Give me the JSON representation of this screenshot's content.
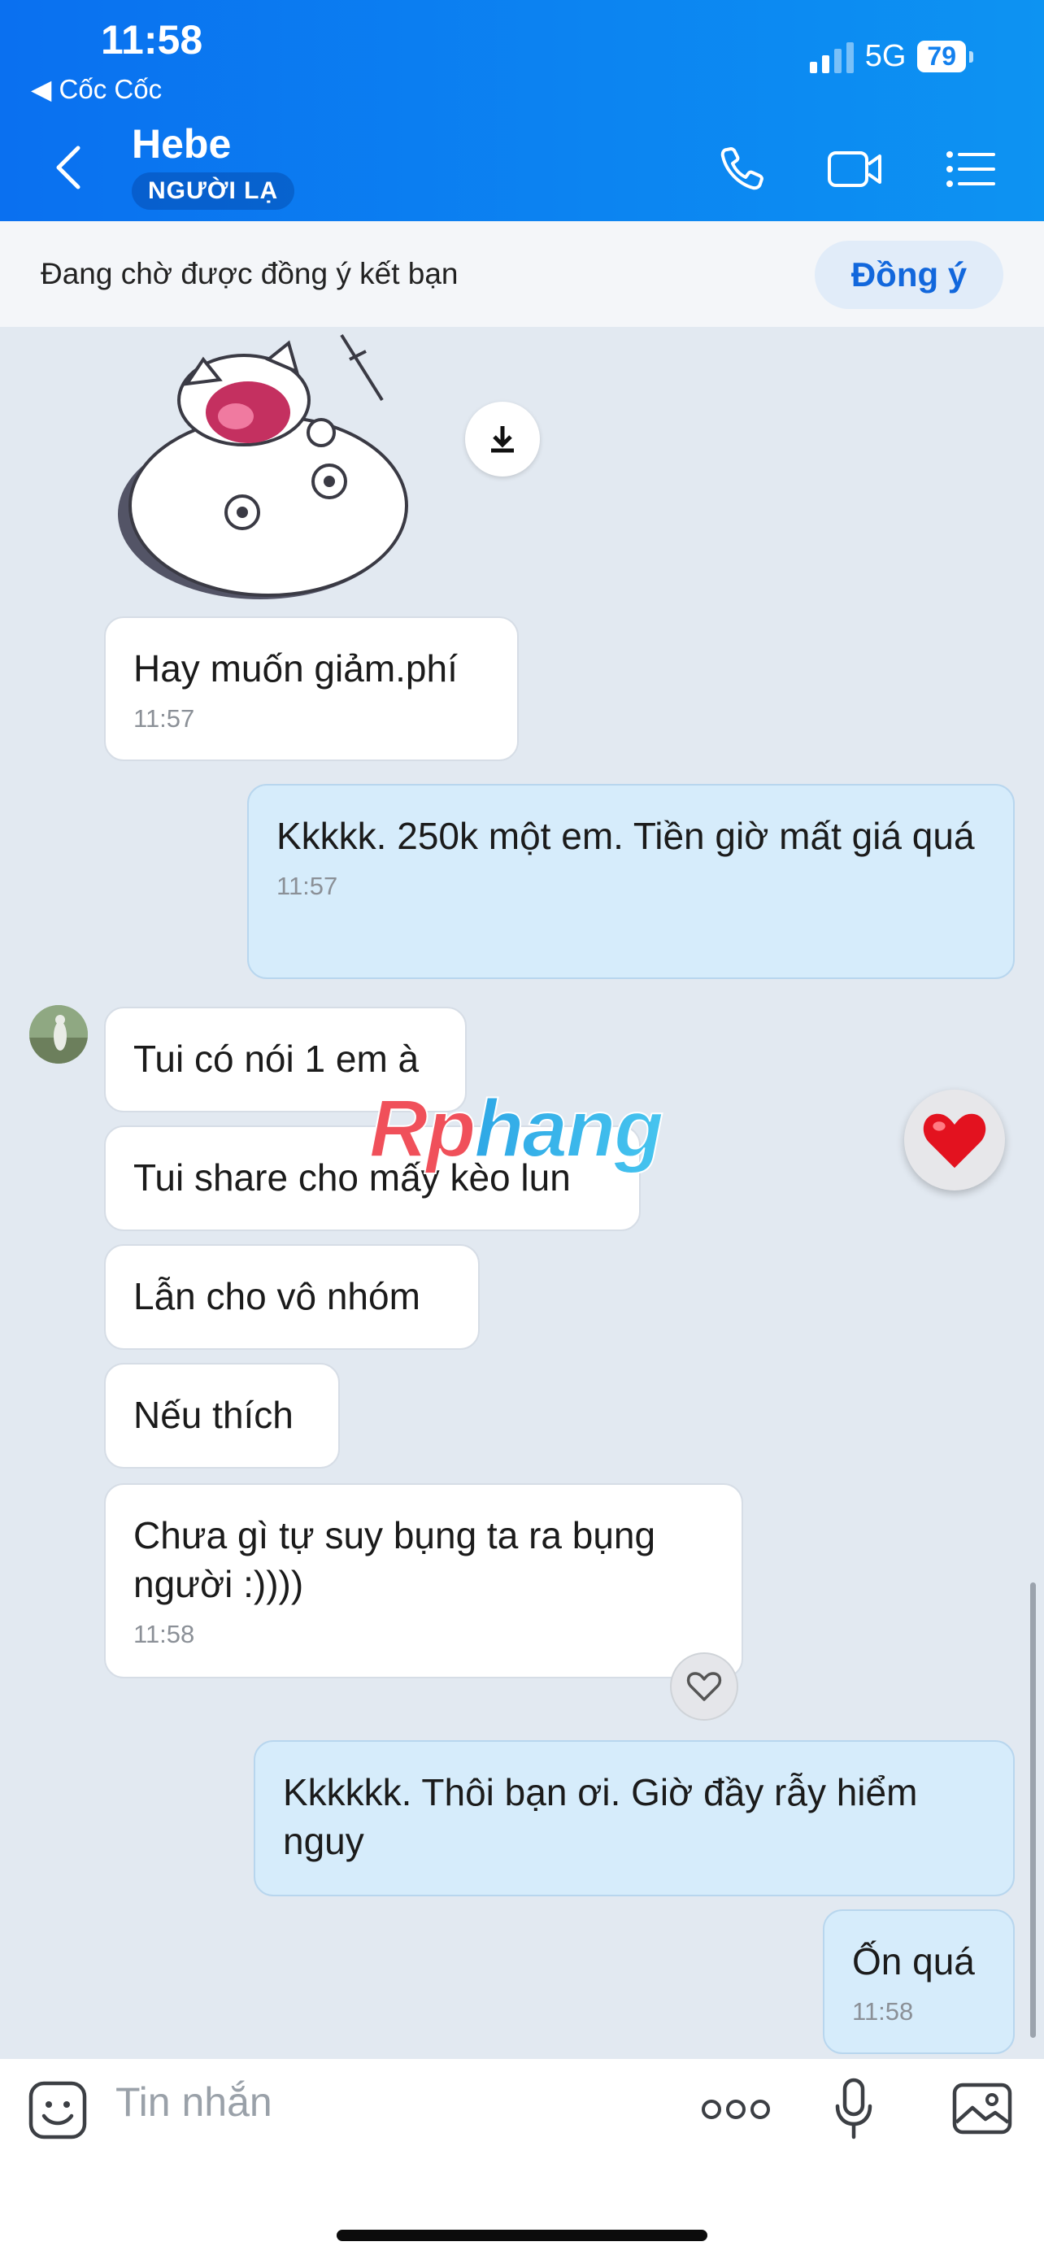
{
  "status_bar": {
    "time": "11:58",
    "back_app": "◀ Cốc Cốc",
    "network": "5G",
    "battery": "79"
  },
  "header": {
    "contact_name": "Hebe",
    "badge": "NGƯỜI LẠ",
    "icons": [
      "back-chevron-icon",
      "phone-icon",
      "video-call-icon",
      "menu-list-icon"
    ]
  },
  "banner": {
    "text": "Đang chờ được đồng ý kết bạn",
    "accept_label": "Đồng ý"
  },
  "watermark": "Rphang",
  "messages": [
    {
      "side": "received",
      "text": "Hay muốn giảm.phí",
      "time": "11:57"
    },
    {
      "side": "sent",
      "text": "Kkkkk. 250k một em. Tiền giờ mất giá quá",
      "time": "11:57"
    },
    {
      "side": "received",
      "text": "Tui có nói 1 em à",
      "time": ""
    },
    {
      "side": "received",
      "text": "Tui share cho mấy kèo lun",
      "time": ""
    },
    {
      "side": "received",
      "text": "Lẫn cho vô nhóm",
      "time": ""
    },
    {
      "side": "received",
      "text": "Nếu thích",
      "time": ""
    },
    {
      "side": "received",
      "text": "Chưa gì tự suy bụng ta ra bụng người :))))",
      "time": "11:58"
    },
    {
      "side": "sent",
      "text": "Kkkkkk. Thôi bạn ơi. Giờ đầy rẫy hiểm nguy",
      "time": ""
    },
    {
      "side": "sent",
      "text": "Ốn quá",
      "time": "11:58"
    }
  ],
  "input_bar": {
    "placeholder": "Tin nhắn",
    "icons": [
      "emoji-icon",
      "more-icon",
      "microphone-icon",
      "image-icon"
    ]
  }
}
